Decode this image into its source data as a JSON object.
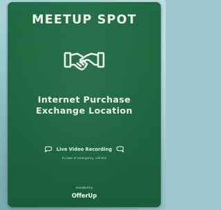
{
  "sign": {
    "title": "MEETUP SPOT",
    "subtitle_line1": "Internet Purchase",
    "subtitle_line2": "Exchange Location",
    "recording_label": "Live Video Recording",
    "emergency_note": "In case of emergency, call 911",
    "donated_label": "Donated by",
    "brand": "OfferUp",
    "icons": [
      "handshake-icon",
      "speech-bubble-icon"
    ],
    "colors": {
      "sign_green": "#1f6b44",
      "text": "#f2f5f1",
      "backdrop": "#9fc9cf"
    }
  }
}
